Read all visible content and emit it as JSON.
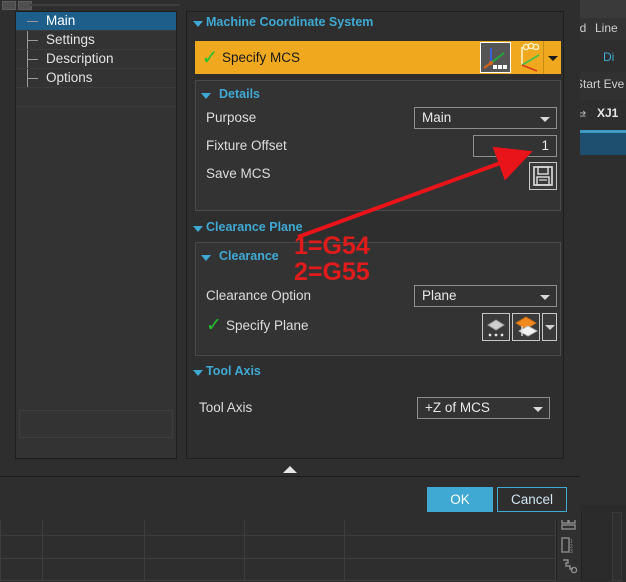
{
  "window": {
    "title_bar_icons": [
      "minimize-icon",
      "restore-icon"
    ]
  },
  "tree": {
    "items": [
      {
        "label": "Main",
        "selected": true
      },
      {
        "label": "Settings",
        "selected": false
      },
      {
        "label": "Description",
        "selected": false
      },
      {
        "label": "Options",
        "selected": false
      }
    ]
  },
  "mcs_group": {
    "title": "Machine Coordinate System",
    "specify_mcs": {
      "label": "Specify MCS",
      "checked": true,
      "check_glyph": "✓",
      "button_csys_icon": "csys-axes-icon",
      "button_construct_icon": "csys-constructor-icon",
      "dropdown_icon": "chevron-down-icon"
    },
    "details": {
      "title": "Details",
      "purpose": {
        "label": "Purpose",
        "value": "Main"
      },
      "fixture_offset": {
        "label": "Fixture Offset",
        "value": "1"
      },
      "save_mcs": {
        "label": "Save MCS",
        "icon": "floppy-disk-icon"
      }
    }
  },
  "clearance_group": {
    "title": "Clearance Plane",
    "clearance": {
      "title": "Clearance",
      "clearance_option": {
        "label": "Clearance Option",
        "value": "Plane"
      },
      "specify_plane": {
        "label": "Specify Plane",
        "checked": true,
        "check_glyph": "✓",
        "button_plane_icon": "plane-diamond-icon",
        "button_plane_stack_icon": "plane-stack-icon",
        "dropdown_icon": "chevron-down-icon"
      }
    }
  },
  "tool_axis_group": {
    "title": "Tool Axis",
    "tool_axis": {
      "label": "Tool Axis",
      "value": "+Z of MCS"
    }
  },
  "annotations": {
    "line1": "1=G54",
    "line2": "2=G55",
    "color": "#e01b1b",
    "arrow_color": "#e8141a",
    "arrow_points_to": "fixture-offset-field"
  },
  "footer": {
    "collapse_icon": "chevron-up-icon",
    "ok_label": "OK",
    "cancel_label": "Cancel"
  },
  "background": {
    "ribbon_fragment_1": "id",
    "ribbon_fragment_2": "Line",
    "dim_fragment": "Di",
    "start_event_fragment": "Start Eve",
    "tab_fragment": "XJ1",
    "tab_icon": "refresh-order-icon",
    "toolbar_icons": [
      "grid-view-icon",
      "numbered-list-icon",
      "wrench-icon"
    ]
  },
  "colors": {
    "accent_blue": "#3fa9d4",
    "highlight_orange": "#f0a81e",
    "check_green": "#22c32a",
    "selection_blue": "#1d5f8a",
    "window_bg": "#2e2e2e"
  }
}
